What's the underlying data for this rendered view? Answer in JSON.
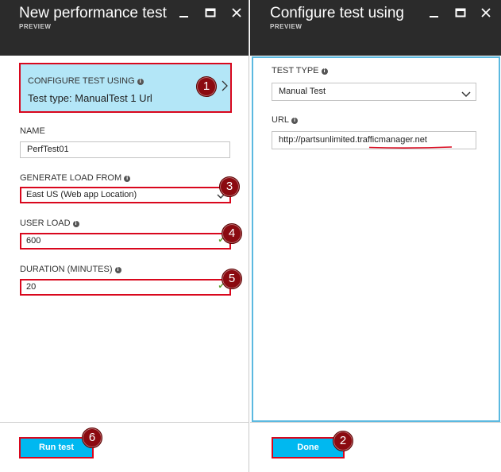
{
  "left_blade": {
    "title": "New performance test",
    "subtitle": "PREVIEW",
    "config_card": {
      "title": "CONFIGURE TEST USING",
      "value": "Test type: ManualTest 1 Url"
    },
    "name": {
      "label": "NAME",
      "value": "PerfTest01"
    },
    "load_from": {
      "label": "GENERATE LOAD FROM",
      "value": "East US (Web app Location)"
    },
    "user_load": {
      "label": "USER LOAD",
      "value": "600"
    },
    "duration": {
      "label": "DURATION (MINUTES)",
      "value": "20"
    },
    "run_button": "Run test"
  },
  "right_blade": {
    "title": "Configure test using",
    "subtitle": "PREVIEW",
    "test_type": {
      "label": "TEST TYPE",
      "value": "Manual Test"
    },
    "url": {
      "label": "URL",
      "value": "http://partsunlimited.trafficmanager.net"
    },
    "done_button": "Done"
  },
  "annotations": [
    "1",
    "2",
    "3",
    "4",
    "5",
    "6"
  ],
  "colors": {
    "header_bg": "#2b2b2b",
    "highlight_red": "#d9071d",
    "badge": "#8b0a10",
    "card_bg": "#b3e6f7",
    "button_bg": "#00b8f0",
    "pane_border": "#5bb9e0",
    "check": "#5aa02c"
  },
  "icons": [
    "minimize-icon",
    "maximize-icon",
    "close-icon",
    "info-icon",
    "chevron-right-icon",
    "chevron-down-icon",
    "check-icon"
  ]
}
